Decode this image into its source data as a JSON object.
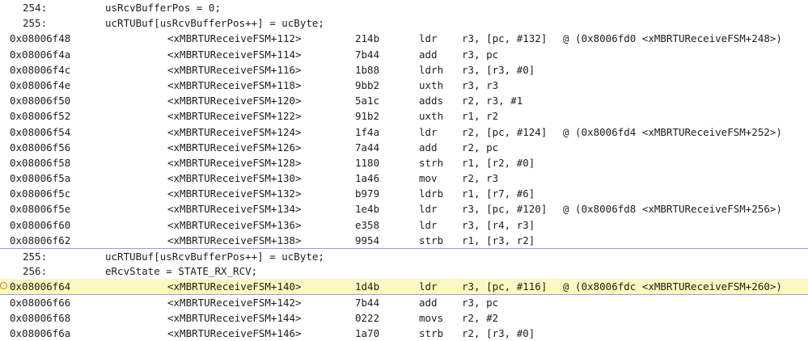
{
  "rows": [
    {
      "kind": "source",
      "line": "254:",
      "code": "usRcvBufferPos = 0;"
    },
    {
      "kind": "source",
      "line": "255:",
      "code": "ucRTUBuf[usRcvBufferPos++] = ucByte;"
    },
    {
      "kind": "asm",
      "addr": "0x08006f48",
      "sym": "<xMBRTUReceiveFSM+112>",
      "op": "214b",
      "mn": "ldr",
      "args": "r3, [pc, #132]",
      "cmt": "@ (0x8006fd0 <xMBRTUReceiveFSM+248>)"
    },
    {
      "kind": "asm",
      "addr": "0x08006f4a",
      "sym": "<xMBRTUReceiveFSM+114>",
      "op": "7b44",
      "mn": "add",
      "args": "r3, pc",
      "cmt": ""
    },
    {
      "kind": "asm",
      "addr": "0x08006f4c",
      "sym": "<xMBRTUReceiveFSM+116>",
      "op": "1b88",
      "mn": "ldrh",
      "args": "r3, [r3, #0]",
      "cmt": ""
    },
    {
      "kind": "asm",
      "addr": "0x08006f4e",
      "sym": "<xMBRTUReceiveFSM+118>",
      "op": "9bb2",
      "mn": "uxth",
      "args": "r3, r3",
      "cmt": ""
    },
    {
      "kind": "asm",
      "addr": "0x08006f50",
      "sym": "<xMBRTUReceiveFSM+120>",
      "op": "5a1c",
      "mn": "adds",
      "args": "r2, r3, #1",
      "cmt": ""
    },
    {
      "kind": "asm",
      "addr": "0x08006f52",
      "sym": "<xMBRTUReceiveFSM+122>",
      "op": "91b2",
      "mn": "uxth",
      "args": "r1, r2",
      "cmt": ""
    },
    {
      "kind": "asm",
      "addr": "0x08006f54",
      "sym": "<xMBRTUReceiveFSM+124>",
      "op": "1f4a",
      "mn": "ldr",
      "args": "r2, [pc, #124]",
      "cmt": "@ (0x8006fd4 <xMBRTUReceiveFSM+252>)"
    },
    {
      "kind": "asm",
      "addr": "0x08006f56",
      "sym": "<xMBRTUReceiveFSM+126>",
      "op": "7a44",
      "mn": "add",
      "args": "r2, pc",
      "cmt": ""
    },
    {
      "kind": "asm",
      "addr": "0x08006f58",
      "sym": "<xMBRTUReceiveFSM+128>",
      "op": "1180",
      "mn": "strh",
      "args": "r1, [r2, #0]",
      "cmt": ""
    },
    {
      "kind": "asm",
      "addr": "0x08006f5a",
      "sym": "<xMBRTUReceiveFSM+130>",
      "op": "1a46",
      "mn": "mov",
      "args": "r2, r3",
      "cmt": ""
    },
    {
      "kind": "asm",
      "addr": "0x08006f5c",
      "sym": "<xMBRTUReceiveFSM+132>",
      "op": "b979",
      "mn": "ldrb",
      "args": "r1, [r7, #6]",
      "cmt": ""
    },
    {
      "kind": "asm",
      "addr": "0x08006f5e",
      "sym": "<xMBRTUReceiveFSM+134>",
      "op": "1e4b",
      "mn": "ldr",
      "args": "r3, [pc, #120]",
      "cmt": "@ (0x8006fd8 <xMBRTUReceiveFSM+256>)"
    },
    {
      "kind": "asm",
      "addr": "0x08006f60",
      "sym": "<xMBRTUReceiveFSM+136>",
      "op": "e358",
      "mn": "ldr",
      "args": "r3, [r4, r3]",
      "cmt": ""
    },
    {
      "kind": "asm",
      "addr": "0x08006f62",
      "sym": "<xMBRTUReceiveFSM+138>",
      "op": "9954",
      "mn": "strb",
      "args": "r1, [r3, r2]",
      "cmt": ""
    },
    {
      "kind": "source",
      "line": "255:",
      "code": "ucRTUBuf[usRcvBufferPos++] = ucByte;"
    },
    {
      "kind": "source",
      "line": "256:",
      "code": "eRcvState = STATE_RX_RCV;"
    },
    {
      "kind": "asm",
      "current": true,
      "addr": "0x08006f64",
      "sym": "<xMBRTUReceiveFSM+140>",
      "op": "1d4b",
      "mn": "ldr",
      "args": "r3, [pc, #116]",
      "cmt": "@ (0x8006fdc <xMBRTUReceiveFSM+260>)"
    },
    {
      "kind": "asm",
      "addr": "0x08006f66",
      "sym": "<xMBRTUReceiveFSM+142>",
      "op": "7b44",
      "mn": "add",
      "args": "r3, pc",
      "cmt": ""
    },
    {
      "kind": "asm",
      "addr": "0x08006f68",
      "sym": "<xMBRTUReceiveFSM+144>",
      "op": "0222",
      "mn": "movs",
      "args": "r2, #2",
      "cmt": ""
    },
    {
      "kind": "asm",
      "addr": "0x08006f6a",
      "sym": "<xMBRTUReceiveFSM+146>",
      "op": "1a70",
      "mn": "strb",
      "args": "r2, [r3, #0]",
      "cmt": ""
    }
  ],
  "colors": {
    "current_line_bg": "#fbf8c3",
    "separator": "#8aa6c8",
    "pc_marker": "#e07a1f",
    "text": "#1e1e1e"
  }
}
